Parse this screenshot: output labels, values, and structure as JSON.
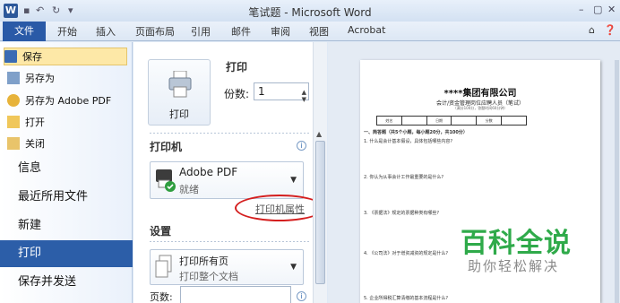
{
  "window": {
    "title": "笔试题 - Microsoft Word",
    "app_icon": "W"
  },
  "tabs": [
    "文件",
    "开始",
    "插入",
    "页面布局",
    "引用",
    "邮件",
    "审阅",
    "视图",
    "Acrobat"
  ],
  "nav": {
    "save": "保存",
    "save_as": "另存为",
    "save_as_pdf": "另存为 Adobe PDF",
    "open": "打开",
    "close": "关闭",
    "info": "信息",
    "recent": "最近所用文件",
    "new": "新建",
    "print": "打印",
    "save_send": "保存并发送"
  },
  "print_panel": {
    "heading": "打印",
    "print_button": "打印",
    "copies_label": "份数:",
    "copies_value": "1",
    "printer_heading": "打印机",
    "printer_name": "Adobe PDF",
    "printer_status": "就绪",
    "printer_properties": "打印机属性",
    "settings_heading": "设置",
    "pages_option_title": "打印所有页",
    "pages_option_desc": "打印整个文档",
    "pages_label": "页数:"
  },
  "document": {
    "title": "****集团有限公司",
    "subtitle": "会计/资金管理岗位应聘人员（笔试）",
    "note": "（满分100分，答题时间60分钟）",
    "table": [
      "姓名",
      "",
      "日期",
      "",
      "分数",
      ""
    ],
    "lines": [
      "一、简答题（共5个小题，每小题20分，共100分）",
      "1. 什么是会计基本假设，具体包括哪些内容?",
      "2. 你认为从事会计工作最重要的是什么?",
      "3. 《票据法》规定的票据种类有哪些?",
      "4. 《公司法》对于增资减资的规定是什么?",
      "5. 企业所得税汇算清缴的基本流程是什么?"
    ]
  },
  "watermark": {
    "title": "百科全说",
    "subtitle": "助你轻松解决"
  }
}
